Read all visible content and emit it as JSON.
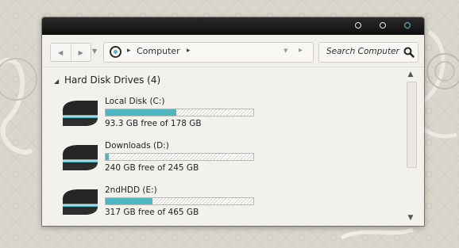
{
  "window": {
    "caption_buttons": [
      "minimize",
      "maximize",
      "close"
    ],
    "accent_color": "#4fb7c2"
  },
  "navigation": {
    "back_icon": "back-arrow-icon",
    "forward_icon": "forward-arrow-icon",
    "address": {
      "path_label": "Computer",
      "icon": "computer-location-icon"
    },
    "search": {
      "placeholder": "Search Computer",
      "icon": "search-icon"
    }
  },
  "group": {
    "title": "Hard Disk Drives (4)"
  },
  "drives": [
    {
      "name": "Local Disk (C:)",
      "free_text": "93.3 GB free of 178 GB",
      "used_fraction": 0.476
    },
    {
      "name": "Downloads (D:)",
      "free_text": "240 GB free of 245 GB",
      "used_fraction": 0.02
    },
    {
      "name": "2ndHDD (E:)",
      "free_text": "317 GB free of 465 GB",
      "used_fraction": 0.318
    }
  ]
}
